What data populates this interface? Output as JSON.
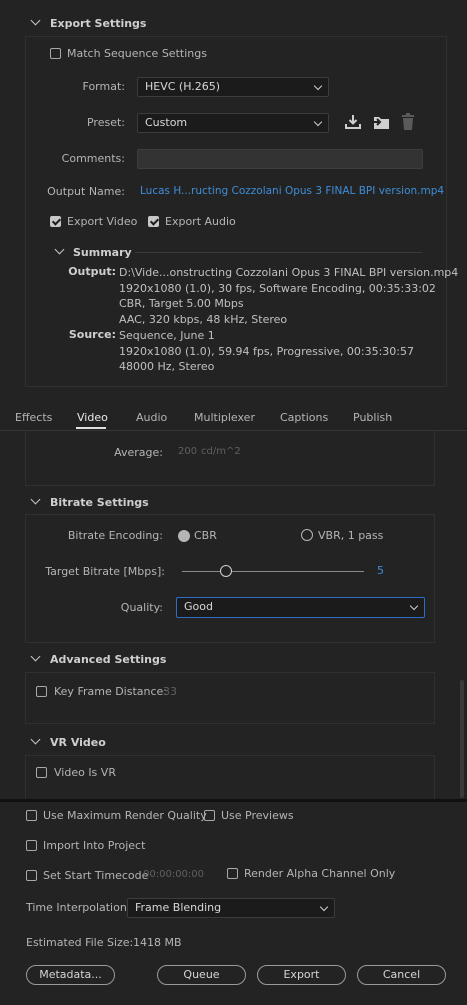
{
  "export_settings": {
    "title": "Export Settings",
    "match_sequence": "Match Sequence Settings",
    "format_label": "Format:",
    "format_value": "HEVC (H.265)",
    "preset_label": "Preset:",
    "preset_value": "Custom",
    "comments_label": "Comments:",
    "comments_value": "",
    "output_name_label": "Output Name:",
    "output_name_value": "Lucas H...ructing Cozzolani Opus 3 FINAL BPI version.mp4",
    "export_video": "Export Video",
    "export_audio": "Export Audio",
    "summary_title": "Summary",
    "output_label": "Output:",
    "output_lines": [
      "D:\\Vide...onstructing Cozzolani Opus 3 FINAL BPI version.mp4",
      "1920x1080 (1.0), 30 fps, Software Encoding, 00:35:33:02",
      "CBR, Target 5.00 Mbps",
      "AAC, 320 kbps, 48 kHz, Stereo"
    ],
    "source_label": "Source:",
    "source_lines": [
      "Sequence, June 1",
      "1920x1080 (1.0), 59.94 fps, Progressive, 00:35:30:57",
      "48000 Hz, Stereo"
    ]
  },
  "tabs": [
    "Effects",
    "Video",
    "Audio",
    "Multiplexer",
    "Captions",
    "Publish"
  ],
  "active_tab": "Video",
  "average": {
    "label": "Average:",
    "value": "200",
    "unit": "cd/m^2"
  },
  "bitrate": {
    "title": "Bitrate Settings",
    "encoding_label": "Bitrate Encoding:",
    "cbr": "CBR",
    "vbr": "VBR, 1 pass",
    "target_label": "Target Bitrate [Mbps]:",
    "target_value": "5",
    "slider_fraction": 0.24,
    "quality_label": "Quality:",
    "quality_value": "Good"
  },
  "advanced": {
    "title": "Advanced Settings",
    "key_frame": "Key Frame Distance:",
    "key_frame_value": "33"
  },
  "vr": {
    "title": "VR Video",
    "video_is_vr": "Video Is VR"
  },
  "bottom": {
    "max_render": "Use Maximum Render Quality",
    "use_previews": "Use Previews",
    "import_project": "Import Into Project",
    "set_start_tc": "Set Start Timecode",
    "start_tc_value": "00:00:00:00",
    "render_alpha": "Render Alpha Channel Only",
    "time_interp_label": "Time Interpolation:",
    "time_interp_value": "Frame Blending",
    "est_size_label": "Estimated File Size:",
    "est_size_value": "1418 MB"
  },
  "buttons": {
    "metadata": "Metadata...",
    "queue": "Queue",
    "export": "Export",
    "cancel": "Cancel"
  },
  "colors": {
    "accent_link": "#3f8ed8",
    "quality_highlight": "#2d6dc6",
    "slider_value": "#3f8ed8"
  },
  "icons": [
    "save-preset-icon",
    "import-preset-icon",
    "delete-preset-icon"
  ]
}
